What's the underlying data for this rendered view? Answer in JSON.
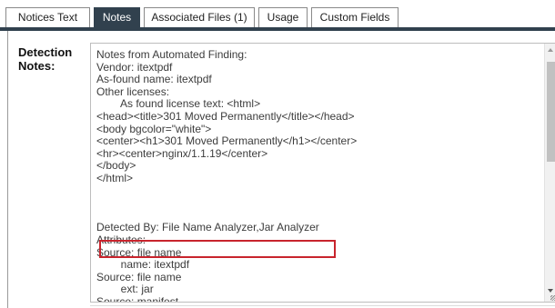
{
  "tabs": [
    {
      "label": "Notices Text",
      "active": false
    },
    {
      "label": "Notes",
      "active": true
    },
    {
      "label": "Associated Files (1)",
      "active": false
    },
    {
      "label": "Usage",
      "active": false
    },
    {
      "label": "Custom Fields",
      "active": false
    }
  ],
  "detection_notes": {
    "label": "Detection\nNotes:",
    "text": "Notes from Automated Finding:\nVendor: itextpdf\nAs-found name: itextpdf\nOther licenses:\n        As found license text: <html>\n<head><title>301 Moved Permanently</title></head>\n<body bgcolor=\"white\">\n<center><h1>301 Moved Permanently</h1></center>\n<hr><center>nginx/1.1.19</center>\n</body>\n</html>\n\n\n\nDetected By: File Name Analyzer,Jar Analyzer\nAttributes:\nSource: file name\n        name: itextpdf\nSource: file name\n        ext: jar\nSource: manifest",
    "highlighted_line": "Detected By: File Name Analyzer,Jar Analyzer"
  },
  "colors": {
    "tab_active_bg": "#31414e",
    "highlight_border": "#c8242d"
  }
}
